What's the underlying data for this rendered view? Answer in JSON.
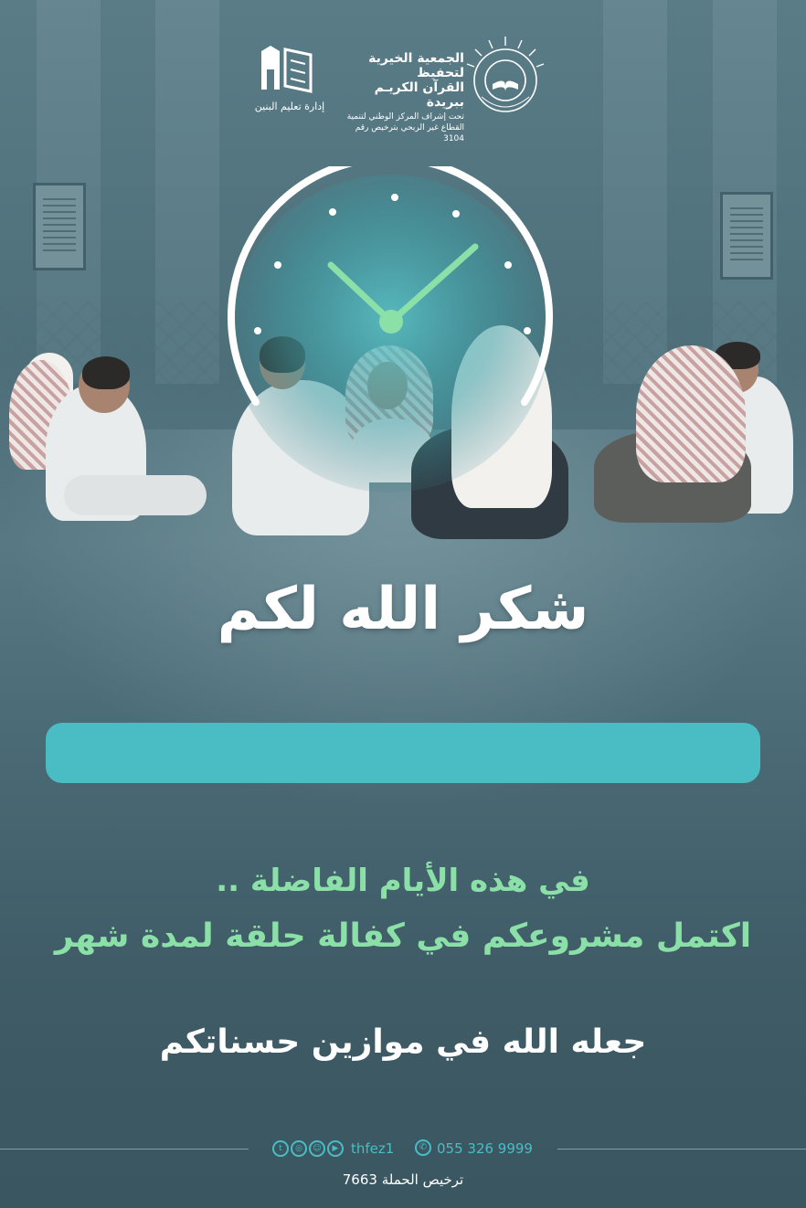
{
  "header": {
    "org_name_line1": "الجمعية الخيرية لتحفيظ",
    "org_name_line2": "القرآن الكريـم ببريدة",
    "org_sub_line1": "تحت إشراف المركز الوطني لتنمية",
    "org_sub_line2": "القطاع غير الربحي بترخيص رقم 3104",
    "dept_name": "إدارة تعليم البنين",
    "logo_right_icon": "open-book-sunburst-logo",
    "logo_left_icon": "book-building-logo"
  },
  "clock": {
    "icon": "clock-icon",
    "hand_color": "#8be0a8",
    "face_color": "#49bdc3"
  },
  "main": {
    "headline": "شكر الله لكم",
    "line1": "في هذه الأيام الفاضلة ..",
    "line2": "اكتمل مشروعكم في كفالة حلقة لمدة شهر",
    "line3": "جعله الله في موازين حسناتكم"
  },
  "footer": {
    "social_icons": [
      "twitter-icon",
      "instagram-icon",
      "snapchat-icon",
      "youtube-icon"
    ],
    "handle": "thfez1",
    "phone_icon": "whatsapp-icon",
    "phone": "055 326 9999",
    "license": "ترخيص الحملة 7663"
  },
  "colors": {
    "accent": "#49bdc3",
    "green_text": "#8be0a8",
    "white": "#ffffff"
  }
}
